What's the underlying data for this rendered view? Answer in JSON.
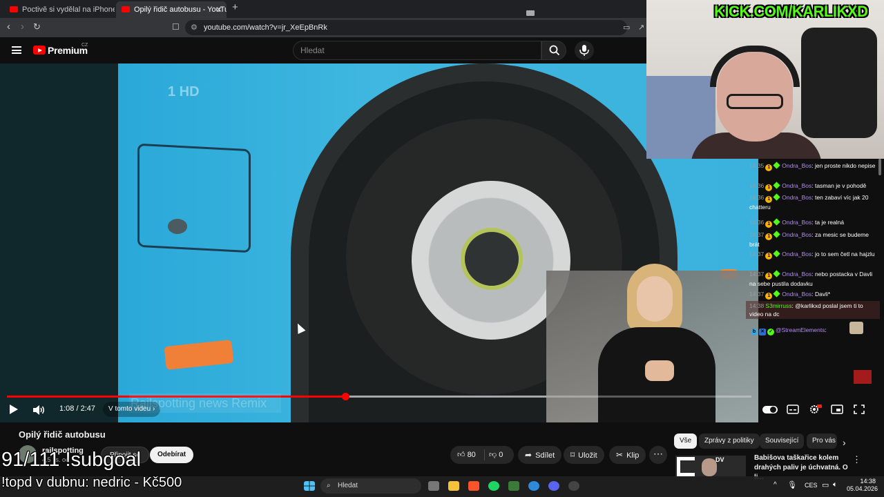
{
  "browser": {
    "tabs": [
      {
        "title": "Poctivě si vydělal na iPhone, policie",
        "active": false
      },
      {
        "title": "Opilý řidič autobusu - YouTube",
        "active": true
      }
    ],
    "url": "youtube.com/watch?v=jr_XeEpBnRk"
  },
  "youtube": {
    "brand": "Premium",
    "region": "CZ",
    "search_placeholder": "Hledat"
  },
  "video": {
    "channel_watermark": "1 HD",
    "overlay_text": "Railspotting news Remix",
    "time": "1:08 / 2:47",
    "chapter_label": "V tomto videu",
    "progress": 0.4548,
    "buffered": 0.7244
  },
  "info": {
    "title": "Opilý řidič autobusu",
    "channel": "railspotting",
    "subscribers": "4,5 tis. od",
    "join_label": "Připojit se",
    "subscribe_label": "Odebírat",
    "likes": "80",
    "dislikes": "0",
    "share_label": "Sdílet",
    "save_label": "Uložit",
    "clip_label": "Klip"
  },
  "recommendations": {
    "chips": [
      "Vše",
      "Zprávy z politiky",
      "Související",
      "Pro vás"
    ],
    "items": [
      {
        "title": "Babišova taškařice kolem drahých paliv je úchvatná. O li...",
        "thumb_label": "DV"
      }
    ]
  },
  "stream": {
    "kick_url": "KICK.COM/KARLIKXD",
    "subgoal": "91/111 !subgoal",
    "topd": "!topd v dubnu: nedric - Kč500",
    "chat": [
      {
        "time": "14:35",
        "user": "Ondra_Bos",
        "text": "jen proste nikdo nepise"
      },
      {
        "time": "14:36",
        "user": "Ondra_Bos",
        "text": "tasman je v pohodě"
      },
      {
        "time": "14:36",
        "user": "Ondra_Bos",
        "text": "ten zabaví víc jak 20 chatteru"
      },
      {
        "time": "14:36",
        "user": "Ondra_Bos",
        "text": "ta je realná"
      },
      {
        "time": "14:37",
        "user": "Ondra_Bos",
        "text": "za mesic se budeme brát"
      },
      {
        "time": "14:37",
        "user": "Ondra_Bos",
        "text": "jo to sem četl na hajzlu"
      },
      {
        "time": "14:37",
        "user": "Ondra_Bos",
        "text": "nebo postacka v Davli na sebe pustila dodavku"
      },
      {
        "time": "14:37",
        "user": "Ondra_Bos",
        "text": "Davli*"
      },
      {
        "time": "14:38",
        "user": "S3mirruss",
        "text": "@karlikxd poslal jsem ti to video na dc"
      },
      {
        "time": "",
        "user": "@StreamElements",
        "text": ""
      }
    ]
  },
  "taskbar": {
    "search": "Hledat",
    "lang": "CES",
    "time": "14:38",
    "date": "05.04.2026"
  },
  "colors": {
    "youtube_red": "#ff0000",
    "kick_green": "#53fc18",
    "chat_user": "#b58cf5"
  }
}
